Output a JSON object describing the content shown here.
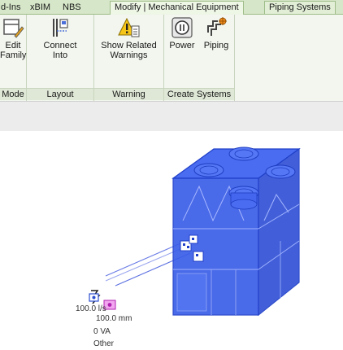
{
  "tabs": [
    {
      "label": "d-Ins"
    },
    {
      "label": "xBIM"
    },
    {
      "label": "NBS"
    },
    {
      "label": "Modify | Mechanical Equipment"
    },
    {
      "label": "Piping Systems"
    }
  ],
  "ribbon": {
    "mode": {
      "title": "Mode",
      "edit_family": {
        "line1": "Edit",
        "line2": "Family"
      }
    },
    "layout": {
      "title": "Layout",
      "connect_into": {
        "line1": "Connect",
        "line2": "Into"
      }
    },
    "warning": {
      "title": "Warning",
      "show_related": {
        "line1": "Show Related",
        "line2": "Warnings"
      }
    },
    "create_systems": {
      "title": "Create Systems",
      "power": "Power",
      "piping": "Piping"
    }
  },
  "canvas": {
    "tag_flow": "100.0 l/s",
    "tag_size": "100.0 mm",
    "tag_power": "0 VA",
    "tag_other": "Other"
  },
  "colors": {
    "ribbon_accent": "#d6e6c8",
    "equipment_blue": "#3a5ee8",
    "connector_line": "#5a6fe0"
  }
}
